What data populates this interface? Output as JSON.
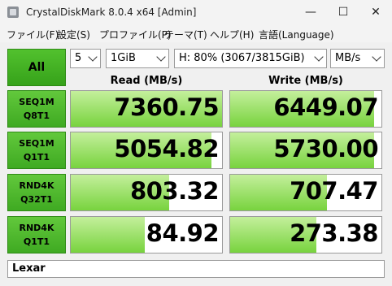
{
  "window": {
    "title": "CrystalDiskMark 8.0.4 x64 [Admin]",
    "minimize": "—",
    "maximize": "☐",
    "close": "✕"
  },
  "menu": [
    "ファイル(F)",
    "設定(S)",
    "プロファイル(P)",
    "テーマ(T)",
    "ヘルプ(H)",
    "言語(Language)"
  ],
  "controls": {
    "all_label": "All",
    "count": "5",
    "size": "1GiB",
    "drive": "H: 80% (3067/3815GiB)",
    "unit": "MB/s"
  },
  "headers": {
    "read": "Read (MB/s)",
    "write": "Write (MB/s)"
  },
  "rows": [
    {
      "line1": "SEQ1M",
      "line2": "Q8T1",
      "read": "7360.75",
      "write": "6449.07",
      "read_fill": 1.0,
      "write_fill": 0.95
    },
    {
      "line1": "SEQ1M",
      "line2": "Q1T1",
      "read": "5054.82",
      "write": "5730.00",
      "read_fill": 0.93,
      "write_fill": 0.95
    },
    {
      "line1": "RND4K",
      "line2": "Q32T1",
      "read": "803.32",
      "write": "707.47",
      "read_fill": 0.65,
      "write_fill": 0.64
    },
    {
      "line1": "RND4K",
      "line2": "Q1T1",
      "read": "84.92",
      "write": "273.38",
      "read_fill": 0.49,
      "write_fill": 0.57
    }
  ],
  "comment": "Lexar"
}
